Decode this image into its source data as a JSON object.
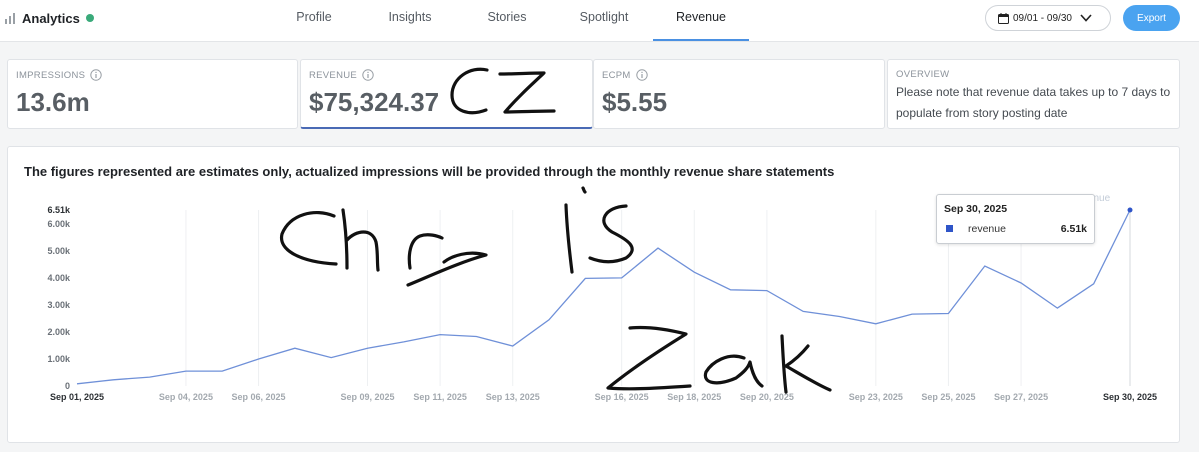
{
  "header": {
    "app_title": "Analytics",
    "status_color": "#3aaa7a",
    "tabs": [
      {
        "label": "Profile",
        "active": false
      },
      {
        "label": "Insights",
        "active": false
      },
      {
        "label": "Stories",
        "active": false
      },
      {
        "label": "Spotlight",
        "active": false
      },
      {
        "label": "Revenue",
        "active": true
      }
    ],
    "date_range": "09/01 - 09/30",
    "export_label": "Export"
  },
  "metrics": {
    "impressions": {
      "label": "IMPRESSIONS",
      "value": "13.6m"
    },
    "revenue": {
      "label": "REVENUE",
      "value": "$75,324.37"
    },
    "ecpm": {
      "label": "ECPM",
      "value": "$5.55"
    },
    "overview": {
      "label": "OVERVIEW",
      "note": "Please note that revenue data takes up to 7 days to populate from story posting date"
    }
  },
  "chart_panel": {
    "title": "The figures represented are estimates only, actualized impressions will be provided through the monthly revenue share statements",
    "tooltip": {
      "date": "Sep 30, 2025",
      "series": "revenue",
      "value": "6.51k",
      "swatch_color": "#2f55c8"
    },
    "legend": [
      {
        "name": "revenue"
      }
    ]
  },
  "chart_data": {
    "type": "line",
    "line_color": "#6f90d8",
    "y_ticks": [
      "0",
      "1.00k",
      "2.00k",
      "3.00k",
      "4.00k",
      "5.00k",
      "6.00k"
    ],
    "y_max_label": "6.51k",
    "ylim": [
      0,
      6510
    ],
    "x_start_label": "Sep 01, 2025",
    "x_end_label": "Sep 30, 2025",
    "x_tick_labels": [
      {
        "day": 4,
        "label": "Sep 04, 2025"
      },
      {
        "day": 6,
        "label": "Sep 06, 2025"
      },
      {
        "day": 9,
        "label": "Sep 09, 2025"
      },
      {
        "day": 11,
        "label": "Sep 11, 2025"
      },
      {
        "day": 13,
        "label": "Sep 13, 2025"
      },
      {
        "day": 16,
        "label": "Sep 16, 2025"
      },
      {
        "day": 18,
        "label": "Sep 18, 2025"
      },
      {
        "day": 20,
        "label": "Sep 20, 2025"
      },
      {
        "day": 23,
        "label": "Sep 23, 2025"
      },
      {
        "day": 25,
        "label": "Sep 25, 2025"
      },
      {
        "day": 27,
        "label": "Sep 27, 2025"
      }
    ],
    "series": [
      {
        "name": "revenue",
        "x": [
          1,
          2,
          3,
          4,
          5,
          6,
          7,
          8,
          9,
          10,
          11,
          12,
          13,
          14,
          15,
          16,
          17,
          18,
          19,
          20,
          21,
          22,
          23,
          24,
          25,
          26,
          27,
          28,
          29,
          30
        ],
        "values": [
          80,
          230,
          330,
          550,
          550,
          1000,
          1400,
          1050,
          1400,
          1630,
          1900,
          1830,
          1480,
          2450,
          3980,
          4000,
          5100,
          4210,
          3560,
          3530,
          2760,
          2570,
          2300,
          2660,
          2680,
          4440,
          3810,
          2880,
          3780,
          6510
        ]
      }
    ],
    "grid": "vertical",
    "legend_position": "top-right"
  },
  "annotations": {
    "ink_color": "#111111",
    "words": [
      "CZ",
      "chris",
      "zak"
    ]
  }
}
